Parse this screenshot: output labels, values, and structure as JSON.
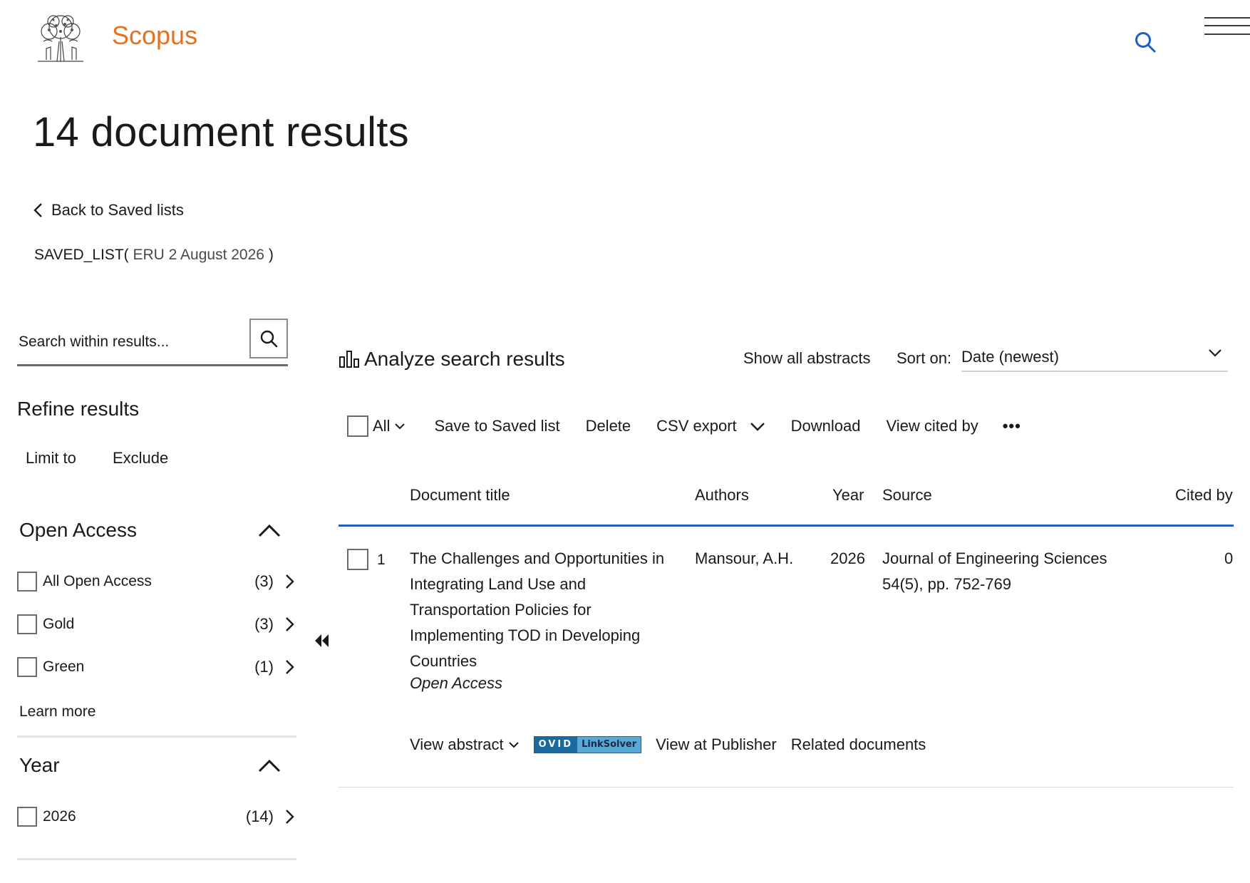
{
  "brand": {
    "name": "Scopus",
    "color": "#e9711c"
  },
  "header": {
    "search_icon": "search-icon",
    "menu_icon": "hamburger-menu-icon"
  },
  "page": {
    "title": "14 document results",
    "back_link": "Back to Saved lists",
    "saved_list_prefix": "SAVED_LIST(",
    "saved_list_name": "ERU 2 August 2026",
    "saved_list_suffix": ")"
  },
  "sidebar": {
    "search_placeholder": "Search within results...",
    "refine_title": "Refine results",
    "limit_to": "Limit to",
    "exclude": "Exclude",
    "facets": [
      {
        "title": "Open Access",
        "options": [
          {
            "label": "All Open Access",
            "count": "(3)"
          },
          {
            "label": "Gold",
            "count": "(3)"
          },
          {
            "label": "Green",
            "count": "(1)"
          }
        ],
        "learn_more": "Learn more"
      },
      {
        "title": "Year",
        "options": [
          {
            "label": "2026",
            "count": "(14)"
          }
        ]
      }
    ]
  },
  "results": {
    "analyze": "Analyze search results",
    "show_all_abstracts": "Show all abstracts",
    "sort_label": "Sort on:",
    "sort_value": "Date (newest)",
    "toolbar": {
      "all": "All",
      "save": "Save to Saved list",
      "delete": "Delete",
      "csv": "CSV export",
      "download": "Download",
      "view_cited": "View cited by",
      "more": "•••"
    },
    "columns": {
      "title": "Document title",
      "authors": "Authors",
      "year": "Year",
      "source": "Source",
      "cited": "Cited by"
    },
    "accent_color": "#1f5ec4",
    "rows": [
      {
        "num": "1",
        "title": "The Challenges and Opportunities in Integrating Land Use and Transportation Policies for Implementing TOD in Developing Countries",
        "access": "Open Access",
        "authors": "Mansour, A.H.",
        "year": "2026",
        "source_line1": "Journal of Engineering Sciences",
        "source_line2": "54(5), pp. 752-769",
        "cited": "0",
        "actions": {
          "view_abstract": "View abstract",
          "ovid_left": "OVID",
          "ovid_right": "LinkSolver",
          "publisher": "View at Publisher",
          "related": "Related documents"
        }
      }
    ]
  }
}
